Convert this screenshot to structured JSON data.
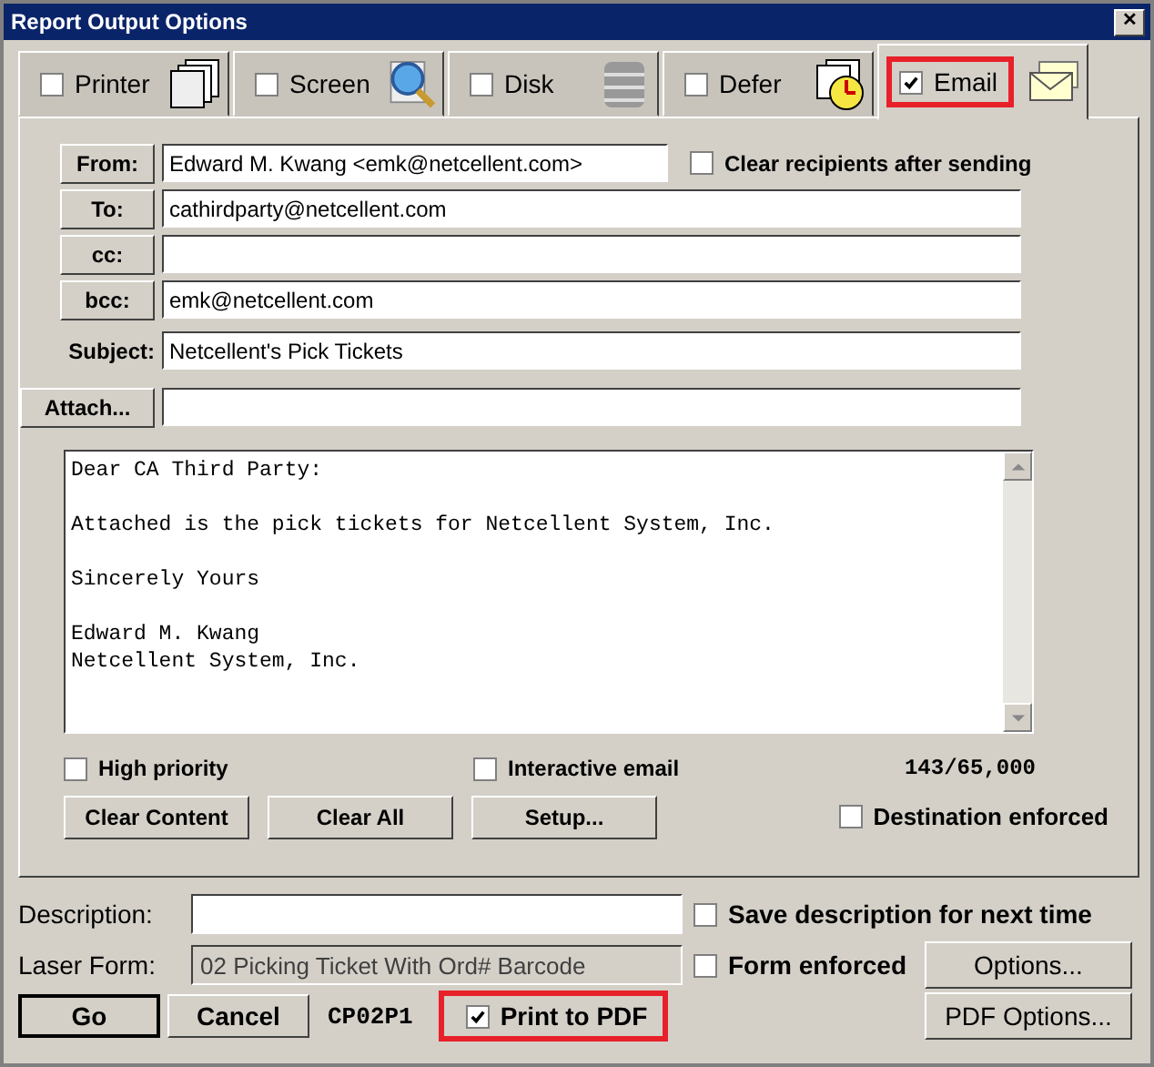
{
  "window": {
    "title": "Report Output Options",
    "close": "✕"
  },
  "tabs": [
    {
      "label": "Printer",
      "kind": "printer",
      "checked": false,
      "selected": false,
      "highlighted": false
    },
    {
      "label": "Screen",
      "kind": "screen",
      "checked": false,
      "selected": false,
      "highlighted": false
    },
    {
      "label": "Disk",
      "kind": "disk",
      "checked": false,
      "selected": false,
      "highlighted": false
    },
    {
      "label": "Defer",
      "kind": "defer",
      "checked": false,
      "selected": false,
      "highlighted": false
    },
    {
      "label": "Email",
      "kind": "email",
      "checked": true,
      "selected": true,
      "highlighted": true
    }
  ],
  "email": {
    "from": {
      "label": "From:",
      "value": "Edward M. Kwang <emk@netcellent.com>"
    },
    "clear_recipients": {
      "label": "Clear recipients after sending",
      "checked": false
    },
    "recipients": [
      {
        "label": "To:",
        "value": "cathirdparty@netcellent.com"
      },
      {
        "label": "cc:"
      },
      {
        "label": "bcc:",
        "value": "emk@netcellent.com"
      }
    ],
    "subject": {
      "label": "Subject:",
      "value": "Netcellent's Pick Tickets"
    },
    "attach": {
      "label": "Attach..."
    },
    "body": "Dear CA Third Party:\n\nAttached is the pick tickets for Netcellent System, Inc.\n\nSincerely Yours\n\nEdward M. Kwang\nNetcellent System, Inc.",
    "options": [
      {
        "label": "High priority",
        "checked": false
      },
      {
        "label": "Interactive email",
        "checked": false
      }
    ],
    "counter": "143/65,000",
    "buttons": [
      "Clear Content",
      "Clear All",
      "Setup..."
    ],
    "destination_enforced": {
      "label": "Destination enforced",
      "checked": false
    }
  },
  "description": {
    "label": "Description:",
    "save": {
      "label": "Save description for next time",
      "checked": false
    }
  },
  "laser_form": {
    "label": "Laser Form:",
    "value": "02 Picking Ticket With Ord# Barcode",
    "disabled": true,
    "enforced": {
      "label": "Form enforced",
      "checked": false
    },
    "button": "Options..."
  },
  "footer": {
    "go": "Go",
    "cancel": "Cancel",
    "code": "CP02P1",
    "print_pdf": {
      "label": "Print to PDF",
      "checked": true,
      "highlighted": true
    },
    "pdf_button": "PDF Options..."
  }
}
